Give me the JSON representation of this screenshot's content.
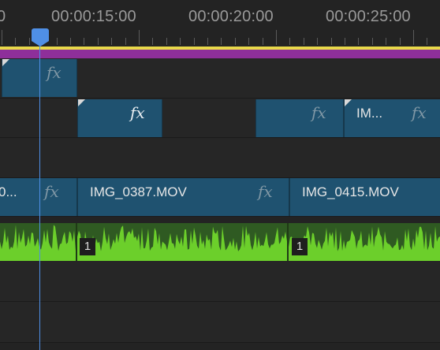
{
  "ruler": {
    "timecodes": [
      "0",
      "00:00:15:00",
      "00:00:20:00",
      "00:00:25:00"
    ]
  },
  "tracks": {
    "v3": {
      "clips": [
        {
          "name": "",
          "fx": "fx"
        }
      ]
    },
    "v2": {
      "clips": [
        {
          "name": "",
          "fx": "fx"
        },
        {
          "name": "",
          "fx": "fx"
        },
        {
          "name": "IM...",
          "fx": "fx"
        }
      ]
    },
    "v1": {
      "clips": [
        {
          "name": "0...",
          "fx": "fx"
        },
        {
          "name": "IMG_0387.MOV",
          "fx": "fx"
        },
        {
          "name": "IMG_0415.MOV",
          "fx": "fx"
        }
      ]
    },
    "a1": {
      "channel_badges": [
        "1",
        "1"
      ]
    }
  },
  "colors": {
    "clip": "#1f5270",
    "audio_wave": "#6ccf2b",
    "playhead": "#4f8fe6",
    "work_area": "#8e2f9a",
    "in_out_bar": "#e8d84a"
  }
}
